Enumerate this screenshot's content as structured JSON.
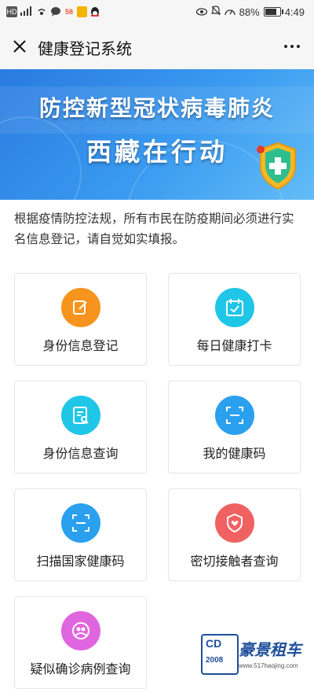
{
  "status_bar": {
    "left_icons": [
      "hd-icon",
      "signal-4g-icon",
      "hotspot-icon",
      "chat-icon",
      "app-58-icon",
      "app-yellow-icon",
      "qq-icon"
    ],
    "right_icons": [
      "eye-icon",
      "mute-icon",
      "speed-icon"
    ],
    "battery_percent": "88%",
    "battery_level": 0.88,
    "time": "4:49"
  },
  "header": {
    "title": "健康登记系统"
  },
  "banner": {
    "title": "防控新型冠状病毒肺炎",
    "subtitle": "西藏在行动"
  },
  "notice": "根据疫情防控法规，所有市民在防疫期间必须进行实名信息登记，请自觉如实填报。",
  "menu": [
    {
      "label": "身份信息登记",
      "icon": "edit-icon",
      "color": "#f7941d"
    },
    {
      "label": "每日健康打卡",
      "icon": "calendar-check-icon",
      "color": "#20c6e8"
    },
    {
      "label": "身份信息查询",
      "icon": "document-search-icon",
      "color": "#20c6e8"
    },
    {
      "label": "我的健康码",
      "icon": "scan-icon",
      "color": "#2aa0ef"
    },
    {
      "label": "扫描国家健康码",
      "icon": "scan-icon",
      "color": "#2aa0ef"
    },
    {
      "label": "密切接触者查询",
      "icon": "shield-heart-icon",
      "color": "#f06262"
    },
    {
      "label": "疑似确诊病例查询",
      "icon": "user-circle-icon",
      "color": "#e066e0"
    }
  ],
  "watermark": {
    "brand_mark": "CD",
    "year": "2008",
    "title": "豪景租车",
    "url": "www.517haojing.com"
  }
}
